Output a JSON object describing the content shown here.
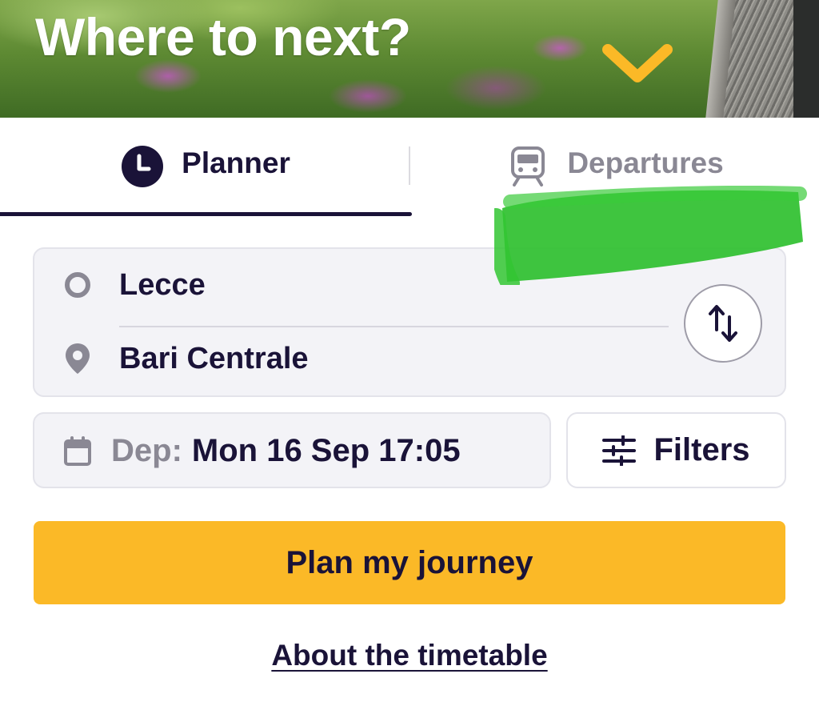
{
  "hero": {
    "title": "Where to next?",
    "chevron_icon": "chevron-down-icon",
    "chevron_color": "#fbb927"
  },
  "tabs": [
    {
      "label": "Planner",
      "icon": "clock-icon",
      "selected": true
    },
    {
      "label": "Departures",
      "icon": "train-icon",
      "selected": false
    }
  ],
  "route": {
    "origin": "Lecce",
    "origin_icon": "origin-circle-icon",
    "destination": "Bari Centrale",
    "destination_icon": "location-pin-icon",
    "swap_icon": "swap-arrows-icon"
  },
  "date": {
    "prefix": "Dep:",
    "value": "Mon 16 Sep 17:05",
    "icon": "calendar-icon"
  },
  "filters": {
    "label": "Filters",
    "icon": "sliders-icon"
  },
  "cta": {
    "label": "Plan my journey",
    "color": "#fbb927"
  },
  "about": {
    "label": "About the timetable"
  },
  "colors": {
    "text_primary": "#1a1338",
    "text_muted": "#8a8894",
    "field_background": "#f3f3f7",
    "annotation_green": "#2fc02f"
  }
}
